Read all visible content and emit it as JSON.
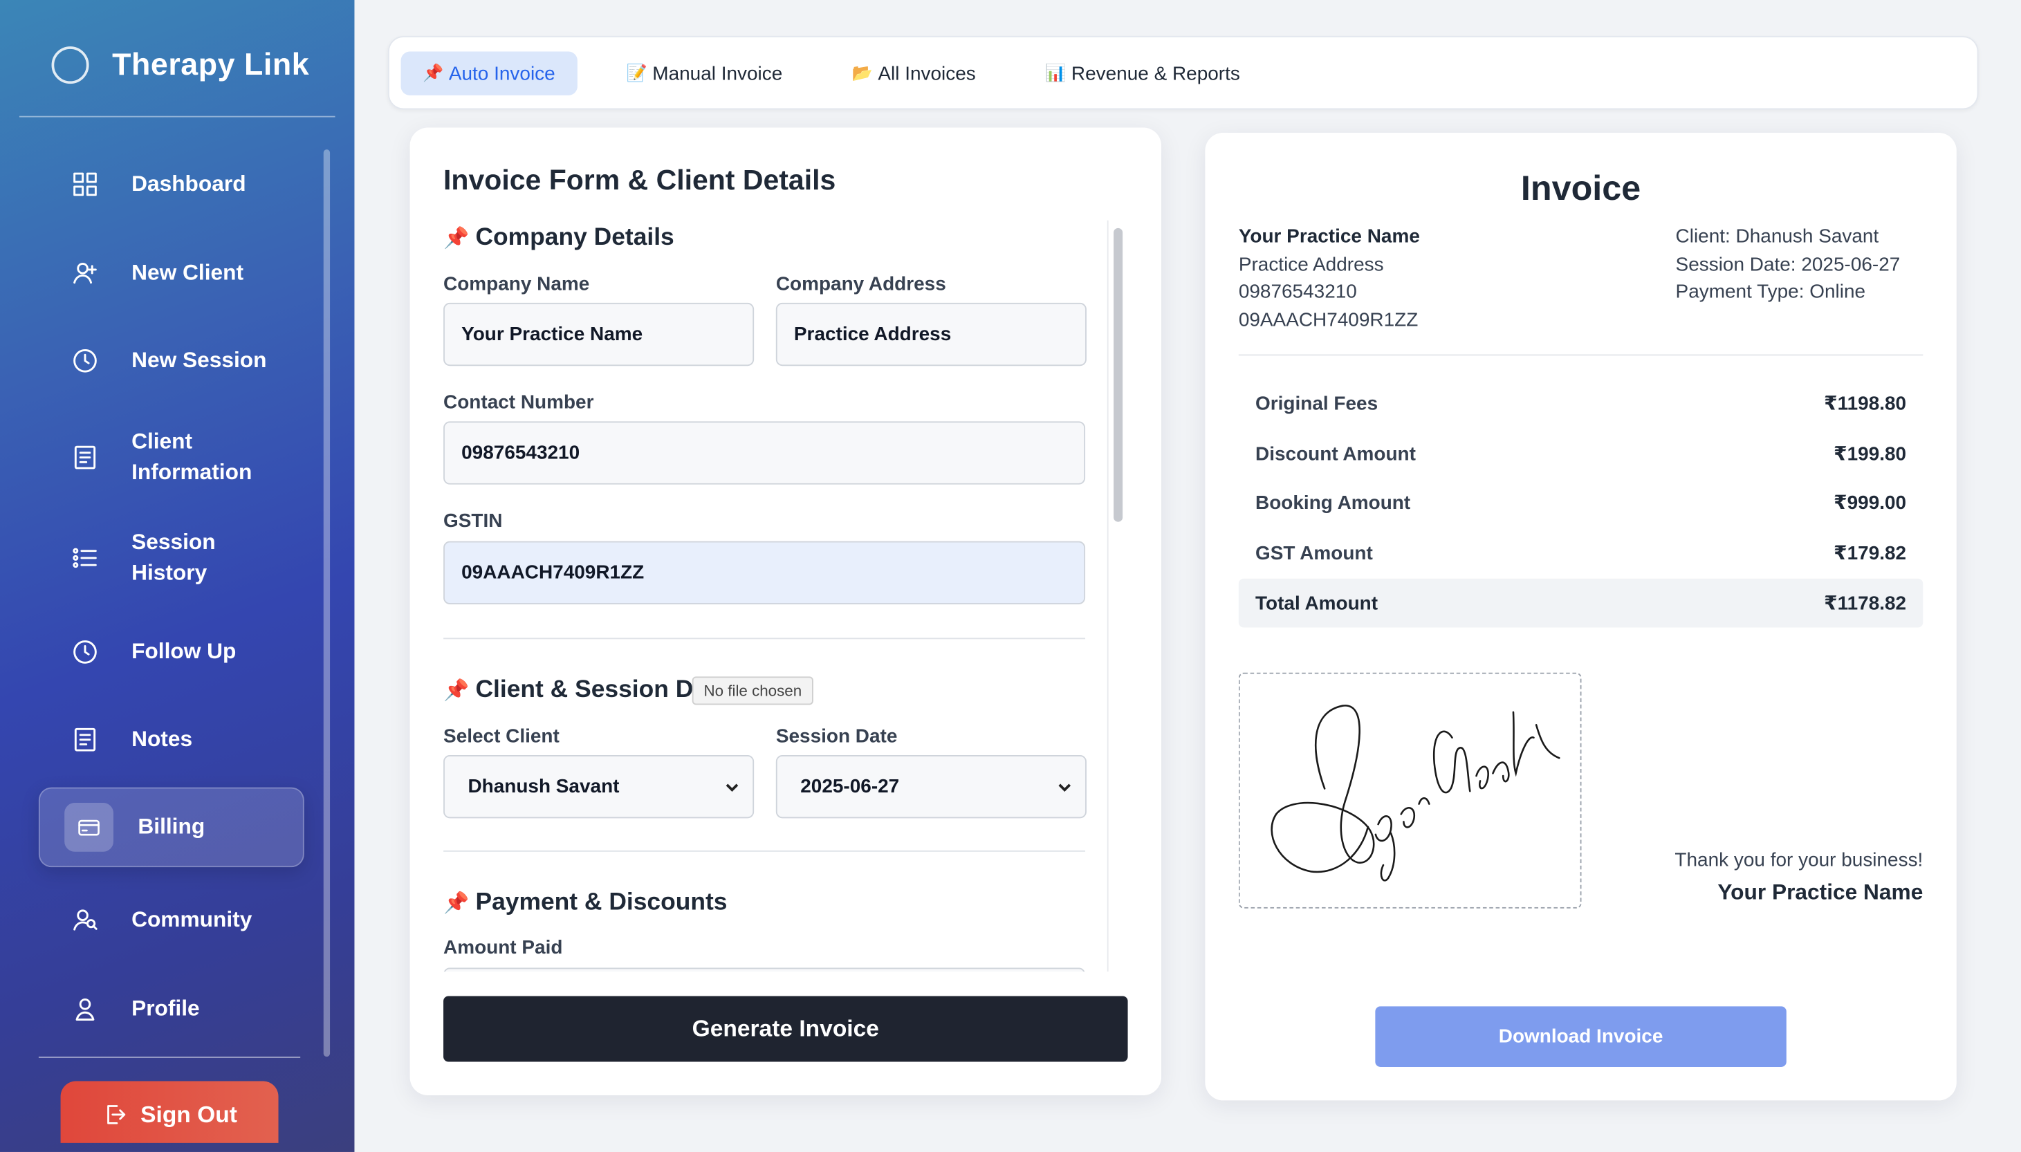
{
  "app": {
    "title": "Therapy Link"
  },
  "sidebar": {
    "items": [
      {
        "label": "Dashboard",
        "icon": "dashboard-grid-icon"
      },
      {
        "label": "New Client",
        "icon": "user-plus-icon"
      },
      {
        "label": "New Session",
        "icon": "clock-icon"
      },
      {
        "label": "Client\nInformation",
        "icon": "document-icon"
      },
      {
        "label": "Session\nHistory",
        "icon": "list-icon"
      },
      {
        "label": "Follow Up",
        "icon": "clock-icon"
      },
      {
        "label": "Notes",
        "icon": "notes-icon"
      },
      {
        "label": "Billing",
        "icon": "credit-card-icon",
        "active": true
      },
      {
        "label": "Community",
        "icon": "users-icon"
      },
      {
        "label": "Profile",
        "icon": "user-icon"
      }
    ],
    "signout_label": "Sign Out"
  },
  "tabs": [
    {
      "label": "Auto Invoice",
      "emoji": "📌",
      "active": true
    },
    {
      "label": "Manual Invoice",
      "emoji": "📝"
    },
    {
      "label": "All Invoices",
      "emoji": "📂"
    },
    {
      "label": "Revenue & Reports",
      "emoji": "📊"
    }
  ],
  "form": {
    "title": "Invoice Form & Client Details",
    "company_section": "Company Details",
    "company_name_label": "Company Name",
    "company_name_value": "Your Practice Name",
    "company_address_label": "Company Address",
    "company_address_value": "Practice Address",
    "contact_label": "Contact Number",
    "contact_value": "09876543210",
    "gstin_label": "GSTIN",
    "gstin_value": "09AAACH7409R1ZZ",
    "client_section": "Client & Session De",
    "tooltip": "No file chosen",
    "select_client_label": "Select Client",
    "select_client_value": "Dhanush Savant",
    "session_date_label": "Session Date",
    "session_date_value": "2025-06-27",
    "payment_section": "Payment & Discounts",
    "amount_paid_label": "Amount Paid",
    "generate_button": "Generate Invoice"
  },
  "invoice": {
    "title": "Invoice",
    "practice_name": "Your Practice Name",
    "practice_address": "Practice Address",
    "phone": "09876543210",
    "gstin": "09AAACH7409R1ZZ",
    "client": "Client: Dhanush Savant",
    "session_date": "Session Date: 2025-06-27",
    "payment_type": "Payment Type: Online",
    "rows": [
      {
        "label": "Original Fees",
        "value": "₹1198.80"
      },
      {
        "label": "Discount Amount",
        "value": "₹199.80"
      },
      {
        "label": "Booking Amount",
        "value": "₹999.00"
      },
      {
        "label": "GST Amount",
        "value": "₹179.82"
      },
      {
        "label": "Total Amount",
        "value": "₹1178.82"
      }
    ],
    "thanks": "Thank you for your business!",
    "thanks_name": "Your Practice Name",
    "download_button": "Download Invoice"
  },
  "colors": {
    "accent": "#2563eb",
    "tab_active_bg": "#dbe7fb",
    "primary_dark": "#1f2430",
    "download_btn": "#7e9cee",
    "signout": "#e0473b"
  }
}
